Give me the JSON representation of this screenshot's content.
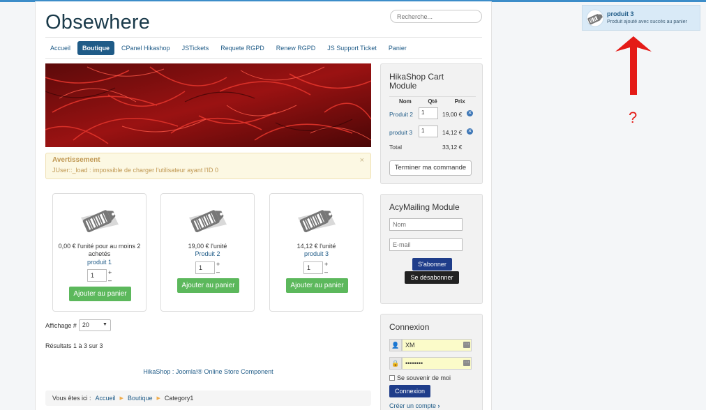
{
  "site": {
    "brand": "Obsewhere",
    "search_placeholder": "Recherche..."
  },
  "nav": [
    {
      "label": "Accueil",
      "active": false
    },
    {
      "label": "Boutique",
      "active": true
    },
    {
      "label": "CPanel Hikashop",
      "active": false
    },
    {
      "label": "JSTickets",
      "active": false
    },
    {
      "label": "Requete RGPD",
      "active": false
    },
    {
      "label": "Renew RGPD",
      "active": false
    },
    {
      "label": "JS Support Ticket",
      "active": false
    },
    {
      "label": "Panier",
      "active": false
    }
  ],
  "alert": {
    "title": "Avertissement",
    "message": "JUser::_load : impossible de charger l'utilisateur ayant l'ID 0",
    "close": "×"
  },
  "products": [
    {
      "price": "0,00 € l'unité pour au moins 2 achetés",
      "name": "produit 1",
      "qty": "1",
      "button": "Ajouter au panier"
    },
    {
      "price": "19,00 € l'unité",
      "name": "Produit 2",
      "qty": "1",
      "button": "Ajouter au panier"
    },
    {
      "price": "14,12 € l'unité",
      "name": "produit 3",
      "qty": "1",
      "button": "Ajouter au panier"
    }
  ],
  "qty_controls": {
    "plus": "+",
    "minus": "–"
  },
  "listing": {
    "affichage_label": "Affichage #",
    "affichage_value": "20",
    "results": "Résultats 1 à 3 sur 3",
    "footer_link": "HikaShop : Joomla!® Online Store Component"
  },
  "breadcrumb": {
    "prefix": "Vous êtes ici :",
    "items": [
      "Accueil",
      "Boutique",
      "Category1"
    ]
  },
  "cart_module": {
    "title": "HikaShop Cart Module",
    "headers": [
      "Nom",
      "Qté",
      "Prix"
    ],
    "rows": [
      {
        "name": "Produit 2",
        "qty": "1",
        "price": "19,00 €"
      },
      {
        "name": "produit 3",
        "qty": "1",
        "price": "14,12 €"
      }
    ],
    "total_label": "Total",
    "total_value": "33,12 €",
    "checkout_button": "Terminer ma commande"
  },
  "acy_module": {
    "title": "AcyMailing Module",
    "name_placeholder": "Nom",
    "email_placeholder": "E-mail",
    "subscribe": "S'abonner",
    "unsubscribe": "Se désabonner"
  },
  "login_module": {
    "title": "Connexion",
    "username": "XM",
    "password": "••••••••",
    "remember": "Se souvenir de moi",
    "login_button": "Connexion",
    "create_account": "Créer un compte"
  },
  "notification": {
    "title": "produit 3",
    "message": "Produit ajouté avec succès au panier"
  },
  "annotation": {
    "question_mark": "?",
    "arrow_color": "#e41b17"
  },
  "colors": {
    "primary": "#1f5b87",
    "success": "#5cb85c",
    "warning_bg": "#fcf8e3"
  }
}
